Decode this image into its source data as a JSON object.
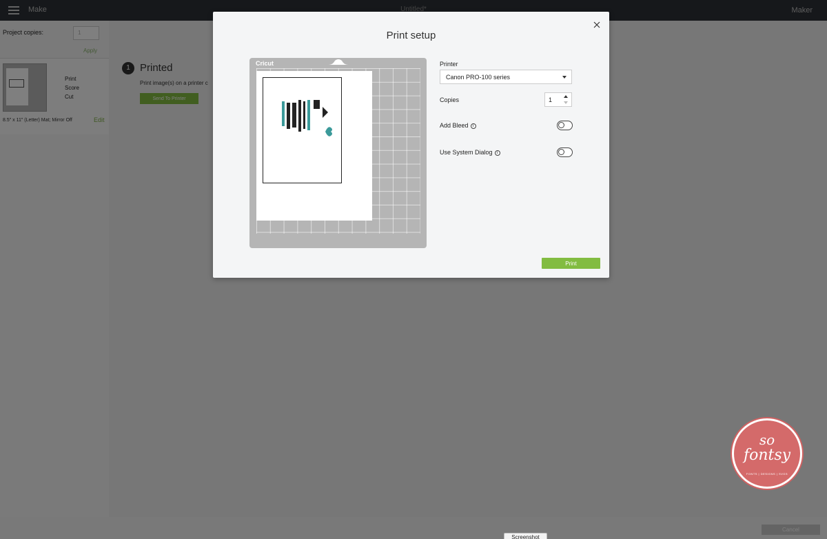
{
  "topbar": {
    "title": "Make",
    "document": "Untitled*",
    "machine": "Maker"
  },
  "left_panel": {
    "project_copies_label": "Project copies:",
    "copies_value": "1",
    "apply_label": "Apply",
    "mat": {
      "operations": [
        "Print",
        "Score",
        "Cut"
      ],
      "description": "8.5\" x 11\" (Letter) Mat; Mirror Off",
      "edit_label": "Edit"
    }
  },
  "main": {
    "step_number": "1",
    "step_title": "Printed",
    "step_description": "Print image(s) on a printer c",
    "send_button": "Send To Printer"
  },
  "modal": {
    "title": "Print setup",
    "mat_brand": "Cricut",
    "printer_label": "Printer",
    "printer_value": "Canon PRO-100 series",
    "copies_label": "Copies",
    "copies_value": "1",
    "bleed_label": "Add Bleed",
    "bleed_enabled": false,
    "system_dialog_label": "Use System Dialog",
    "system_dialog_enabled": false,
    "print_button": "Print"
  },
  "bottom": {
    "screenshot_button": "Screenshot",
    "cancel_button": "Cancel"
  },
  "watermark": {
    "line1": "so",
    "line2": "fontsy",
    "tagline": "FONTS | DESIGNS | SVGS"
  },
  "colors": {
    "accent_green": "#82bc41",
    "topbar": "#2c3136",
    "logo_red": "#d46a6a",
    "teal": "#3b9a9a"
  }
}
